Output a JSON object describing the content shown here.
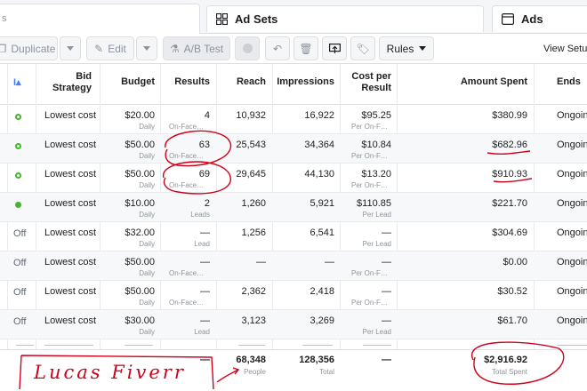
{
  "tabs": {
    "stub": "s",
    "ad_sets": "Ad Sets",
    "ads": "Ads"
  },
  "toolbar": {
    "duplicate": "Duplicate",
    "edit": "Edit",
    "ab_test": "A/B Test",
    "rules": "Rules",
    "view_setup": "View Setup"
  },
  "columns": {
    "bid_strategy_1": "Bid",
    "bid_strategy_2": "Strategy",
    "budget": "Budget",
    "results": "Results",
    "reach": "Reach",
    "impressions": "Impressions",
    "cost_per_result_1": "Cost per",
    "cost_per_result_2": "Result",
    "amount_spent": "Amount Spent",
    "ends": "Ends"
  },
  "rows": [
    {
      "status": "",
      "bid": "Lowest cost",
      "budget": "$20.00",
      "budget_sub": "Daily",
      "results": "4",
      "results_sub": "On-Face…",
      "reach": "10,932",
      "impressions": "16,922",
      "cpr": "$95.25",
      "cpr_sub": "Per On-F…",
      "spent": "$380.99",
      "ends": "Ongoing"
    },
    {
      "status": "",
      "bid": "Lowest cost",
      "budget": "$50.00",
      "budget_sub": "Daily",
      "results": "63",
      "results_sub": "On-Face…",
      "reach": "25,543",
      "impressions": "34,364",
      "cpr": "$10.84",
      "cpr_sub": "Per On-F…",
      "spent": "$682.96",
      "ends": "Ongoing"
    },
    {
      "status": "",
      "bid": "Lowest cost",
      "budget": "$50.00",
      "budget_sub": "Daily",
      "results": "69",
      "results_sub": "On-Face…",
      "reach": "29,645",
      "impressions": "44,130",
      "cpr": "$13.20",
      "cpr_sub": "Per On-F…",
      "spent": "$910.93",
      "ends": "Ongoing"
    },
    {
      "status": "",
      "bid": "Lowest cost",
      "budget": "$10.00",
      "budget_sub": "Daily",
      "results": "2",
      "results_sub": "Leads",
      "reach": "1,260",
      "impressions": "5,921",
      "cpr": "$110.85",
      "cpr_sub": "Per Lead",
      "spent": "$221.70",
      "ends": "Ongoing"
    },
    {
      "status": "Off",
      "bid": "Lowest cost",
      "budget": "$32.00",
      "budget_sub": "Daily",
      "results": "—",
      "results_sub": "Lead",
      "reach": "1,256",
      "impressions": "6,541",
      "cpr": "—",
      "cpr_sub": "Per Lead",
      "spent": "$304.69",
      "ends": "Ongoing"
    },
    {
      "status": "Off",
      "bid": "Lowest cost",
      "budget": "$50.00",
      "budget_sub": "Daily",
      "results": "—",
      "results_sub": "On-Face…",
      "reach": "—",
      "impressions": "—",
      "cpr": "—",
      "cpr_sub": "Per On-F…",
      "spent": "$0.00",
      "ends": "Ongoing"
    },
    {
      "status": "Off",
      "bid": "Lowest cost",
      "budget": "$50.00",
      "budget_sub": "Daily",
      "results": "—",
      "results_sub": "On-Face…",
      "reach": "2,362",
      "impressions": "2,418",
      "cpr": "—",
      "cpr_sub": "Per On-F…",
      "spent": "$30.52",
      "ends": "Ongoing"
    },
    {
      "status": "Off",
      "bid": "Lowest cost",
      "budget": "$30.00",
      "budget_sub": "Daily",
      "results": "—",
      "results_sub": "Lead",
      "reach": "3,123",
      "impressions": "3,269",
      "cpr": "—",
      "cpr_sub": "Per Lead",
      "spent": "$61.70",
      "ends": "Ongoing"
    }
  ],
  "totals": {
    "results": "—",
    "reach": "68,348",
    "reach_sub": "People",
    "impressions": "128,356",
    "impressions_sub": "Total",
    "cpr": "—",
    "spent": "$2,916.92",
    "spent_sub": "Total Spent"
  },
  "annotation": {
    "handwriting": "Lucas Fiverr"
  },
  "colors": {
    "active_green": "#42b72a",
    "annotation_red": "#d0021b"
  }
}
